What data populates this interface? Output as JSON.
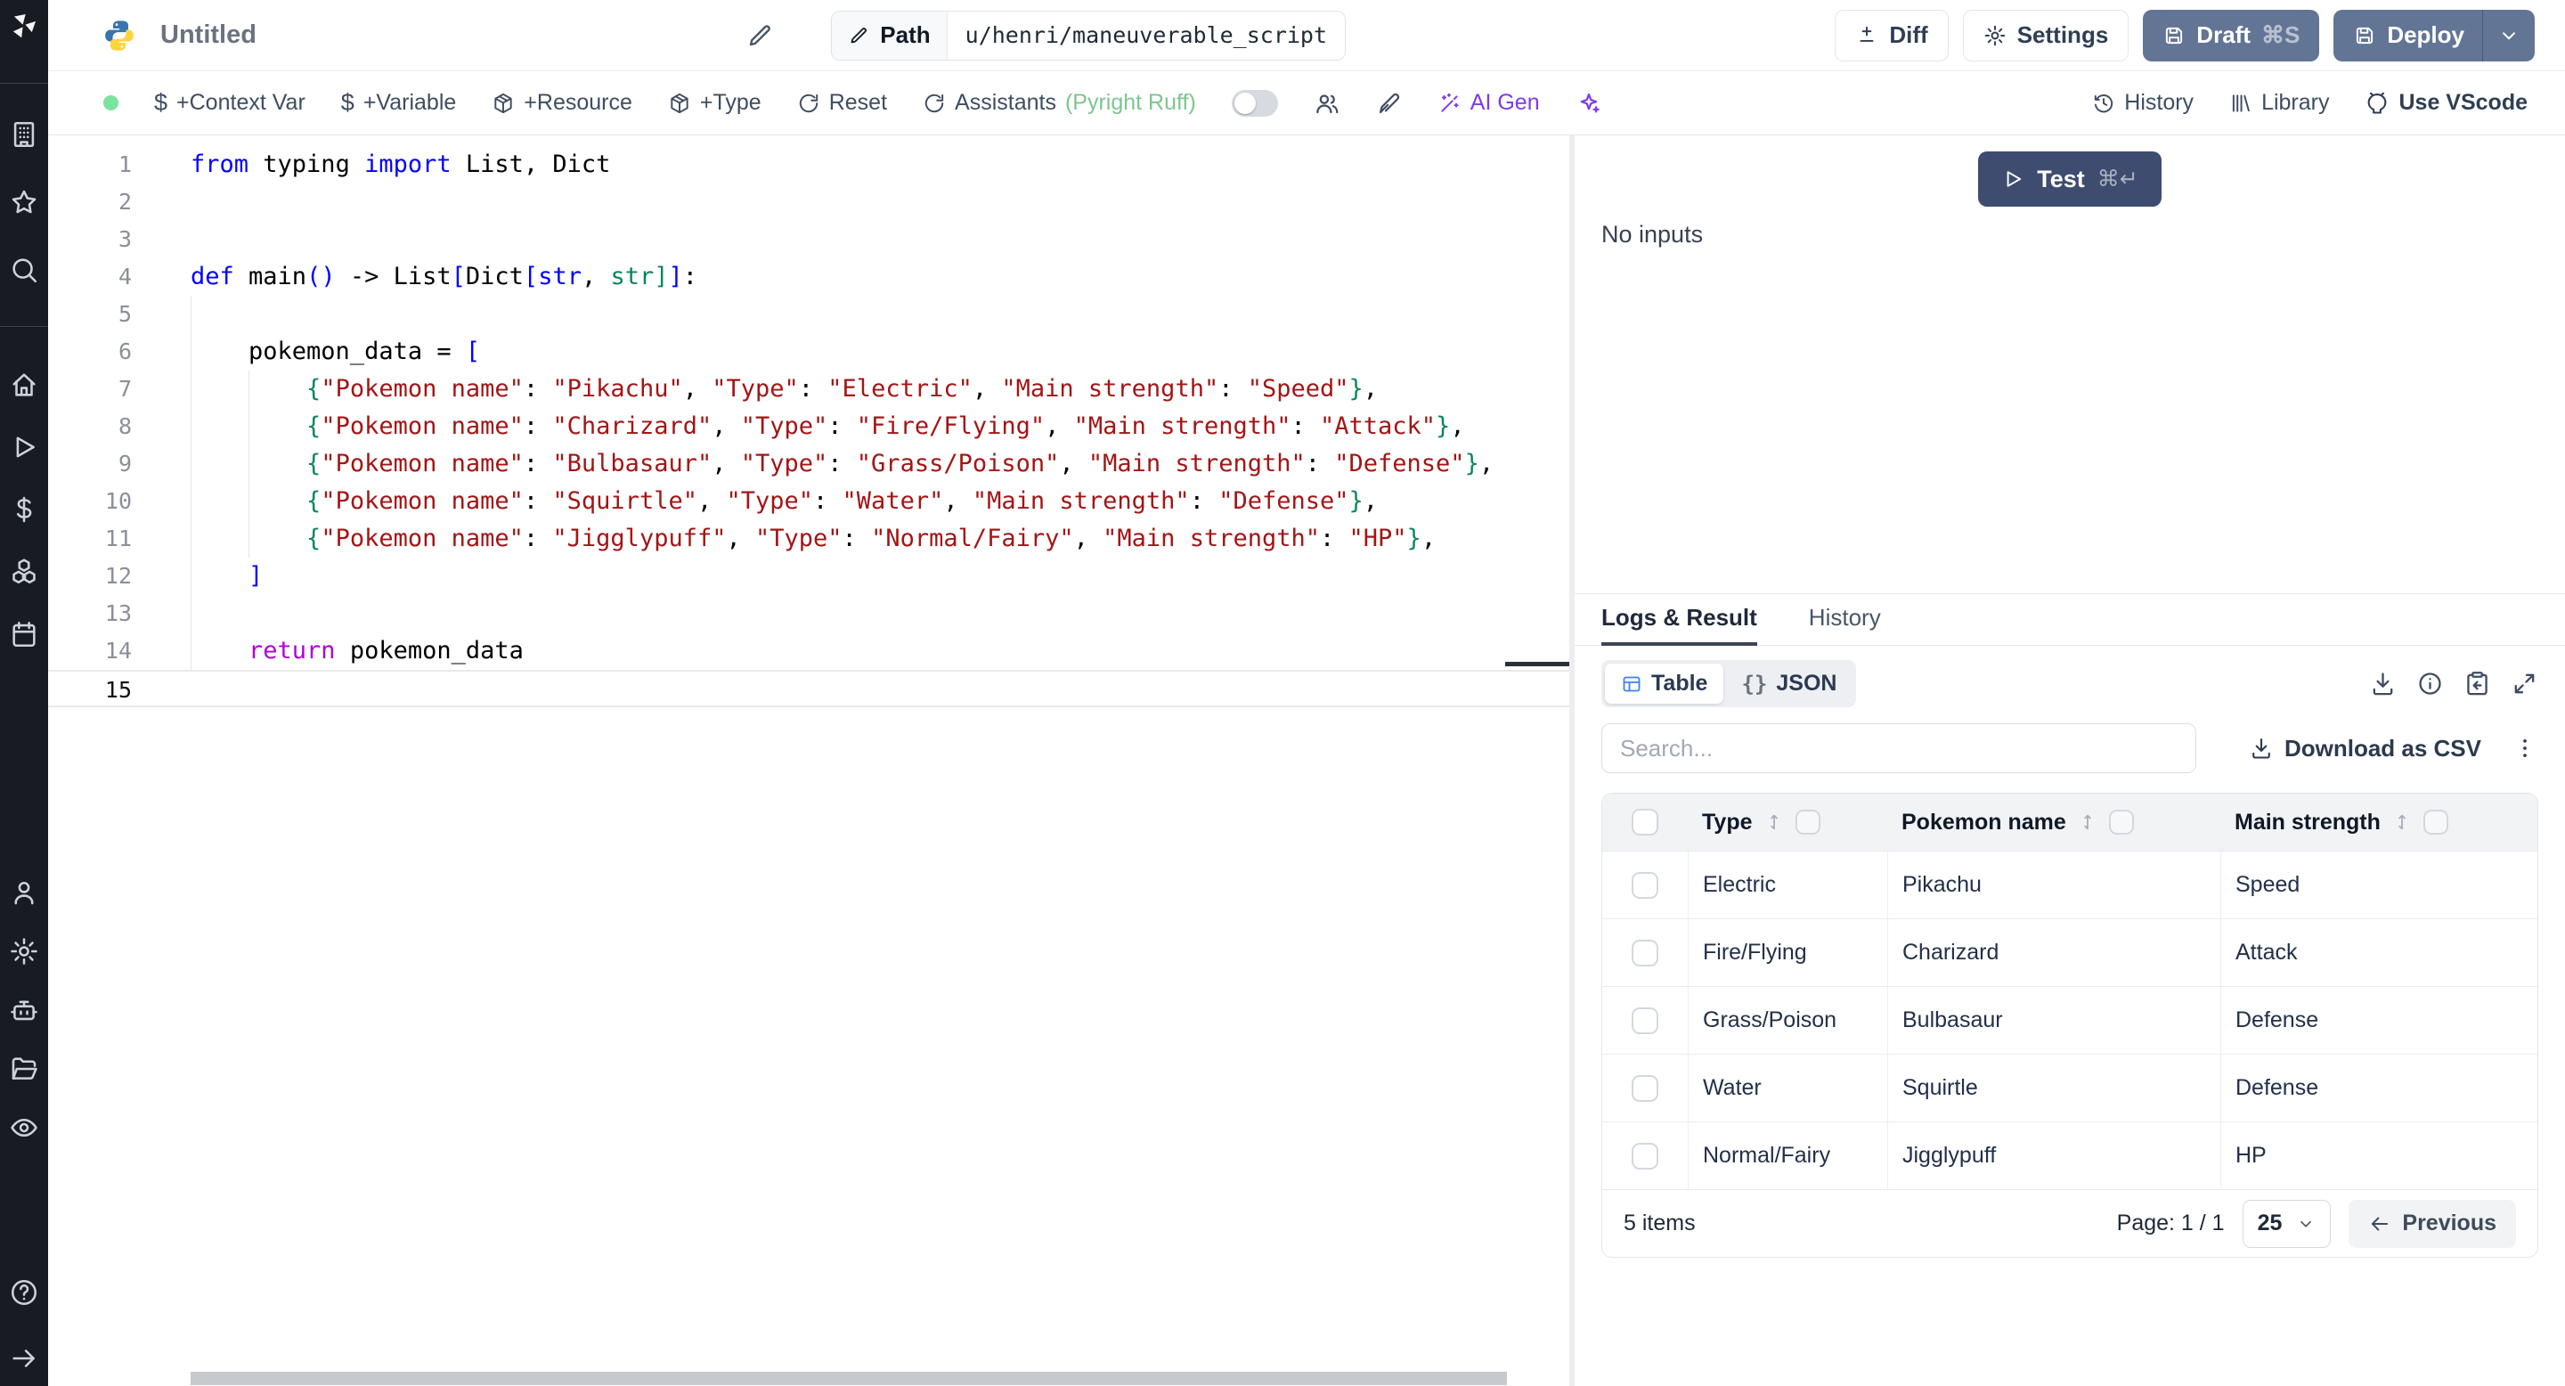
{
  "topbar": {
    "title": "Untitled",
    "path_label": "Path",
    "path_value": "u/henri/maneuverable_script",
    "diff_label": "Diff",
    "settings_label": "Settings",
    "draft_label": "Draft",
    "draft_shortcut": "⌘S",
    "deploy_label": "Deploy"
  },
  "toolbar": {
    "context_var": "+Context Var",
    "variable": "+Variable",
    "resource": "+Resource",
    "type": "+Type",
    "reset": "Reset",
    "assistants": "Assistants",
    "assistants_detail": "(Pyright Ruff)",
    "ai_gen": "AI Gen",
    "history": "History",
    "library": "Library",
    "use_vscode": "Use VScode"
  },
  "sidebar": {
    "groups": [
      [
        "workspace",
        "favorites",
        "search"
      ],
      [
        "home",
        "runs",
        "variables",
        "resources",
        "schedules"
      ],
      [
        "users",
        "settings",
        "workers",
        "folders",
        "audit-logs"
      ],
      [
        "help",
        "expand"
      ]
    ]
  },
  "editor": {
    "lines": [
      {
        "n": 1,
        "seg": [
          [
            "kw",
            "from"
          ],
          [
            "pl",
            " typing "
          ],
          [
            "kw",
            "import"
          ],
          [
            "pl",
            " List, Dict"
          ]
        ]
      },
      {
        "n": 2,
        "seg": []
      },
      {
        "n": 3,
        "seg": []
      },
      {
        "n": 4,
        "seg": [
          [
            "kw",
            "def"
          ],
          [
            "pl",
            " main"
          ],
          [
            "kw",
            "()"
          ],
          [
            "pl",
            " -> List"
          ],
          [
            "kw",
            "["
          ],
          [
            "pl",
            "Dict"
          ],
          [
            "kw",
            "["
          ],
          [
            "kw",
            "str"
          ],
          [
            "pl",
            ", "
          ],
          [
            "grn",
            "str"
          ],
          [
            "grn",
            "]"
          ],
          [
            "kw",
            "]"
          ],
          [
            "pl",
            ":"
          ]
        ]
      },
      {
        "n": 5,
        "seg": [],
        "g": [
          0
        ]
      },
      {
        "n": 6,
        "seg": [
          [
            "pl",
            "    pokemon_data = "
          ],
          [
            "kw",
            "["
          ]
        ],
        "g": [
          0
        ]
      },
      {
        "n": 7,
        "g": [
          0,
          4
        ],
        "seg": [
          [
            "pl",
            "        "
          ],
          [
            "grn",
            "{"
          ],
          [
            "str",
            "\"Pokemon name\""
          ],
          [
            "pl",
            ": "
          ],
          [
            "str",
            "\"Pikachu\""
          ],
          [
            "pl",
            ", "
          ],
          [
            "str",
            "\"Type\""
          ],
          [
            "pl",
            ": "
          ],
          [
            "str",
            "\"Electric\""
          ],
          [
            "pl",
            ", "
          ],
          [
            "str",
            "\"Main strength\""
          ],
          [
            "pl",
            ": "
          ],
          [
            "str",
            "\"Speed\""
          ],
          [
            "grn",
            "}"
          ],
          [
            "pl",
            ","
          ]
        ]
      },
      {
        "n": 8,
        "g": [
          0,
          4
        ],
        "seg": [
          [
            "pl",
            "        "
          ],
          [
            "grn",
            "{"
          ],
          [
            "str",
            "\"Pokemon name\""
          ],
          [
            "pl",
            ": "
          ],
          [
            "str",
            "\"Charizard\""
          ],
          [
            "pl",
            ", "
          ],
          [
            "str",
            "\"Type\""
          ],
          [
            "pl",
            ": "
          ],
          [
            "str",
            "\"Fire/Flying\""
          ],
          [
            "pl",
            ", "
          ],
          [
            "str",
            "\"Main strength\""
          ],
          [
            "pl",
            ": "
          ],
          [
            "str",
            "\"Attack\""
          ],
          [
            "grn",
            "}"
          ],
          [
            "pl",
            ","
          ]
        ]
      },
      {
        "n": 9,
        "g": [
          0,
          4
        ],
        "seg": [
          [
            "pl",
            "        "
          ],
          [
            "grn",
            "{"
          ],
          [
            "str",
            "\"Pokemon name\""
          ],
          [
            "pl",
            ": "
          ],
          [
            "str",
            "\"Bulbasaur\""
          ],
          [
            "pl",
            ", "
          ],
          [
            "str",
            "\"Type\""
          ],
          [
            "pl",
            ": "
          ],
          [
            "str",
            "\"Grass/Poison\""
          ],
          [
            "pl",
            ", "
          ],
          [
            "str",
            "\"Main strength\""
          ],
          [
            "pl",
            ": "
          ],
          [
            "str",
            "\"Defense\""
          ],
          [
            "grn",
            "}"
          ],
          [
            "pl",
            ","
          ]
        ]
      },
      {
        "n": 10,
        "g": [
          0,
          4
        ],
        "seg": [
          [
            "pl",
            "        "
          ],
          [
            "grn",
            "{"
          ],
          [
            "str",
            "\"Pokemon name\""
          ],
          [
            "pl",
            ": "
          ],
          [
            "str",
            "\"Squirtle\""
          ],
          [
            "pl",
            ", "
          ],
          [
            "str",
            "\"Type\""
          ],
          [
            "pl",
            ": "
          ],
          [
            "str",
            "\"Water\""
          ],
          [
            "pl",
            ", "
          ],
          [
            "str",
            "\"Main strength\""
          ],
          [
            "pl",
            ": "
          ],
          [
            "str",
            "\"Defense\""
          ],
          [
            "grn",
            "}"
          ],
          [
            "pl",
            ","
          ]
        ]
      },
      {
        "n": 11,
        "g": [
          0,
          4
        ],
        "seg": [
          [
            "pl",
            "        "
          ],
          [
            "grn",
            "{"
          ],
          [
            "str",
            "\"Pokemon name\""
          ],
          [
            "pl",
            ": "
          ],
          [
            "str",
            "\"Jigglypuff\""
          ],
          [
            "pl",
            ", "
          ],
          [
            "str",
            "\"Type\""
          ],
          [
            "pl",
            ": "
          ],
          [
            "str",
            "\"Normal/Fairy\""
          ],
          [
            "pl",
            ", "
          ],
          [
            "str",
            "\"Main strength\""
          ],
          [
            "pl",
            ": "
          ],
          [
            "str",
            "\"HP\""
          ],
          [
            "grn",
            "}"
          ],
          [
            "pl",
            ","
          ]
        ]
      },
      {
        "n": 12,
        "g": [
          0
        ],
        "seg": [
          [
            "pl",
            "    "
          ],
          [
            "kw",
            "]"
          ]
        ]
      },
      {
        "n": 13,
        "seg": [],
        "g": [
          0
        ]
      },
      {
        "n": 14,
        "g": [
          0
        ],
        "seg": [
          [
            "pl",
            "    "
          ],
          [
            "ctrl",
            "return"
          ],
          [
            "pl",
            " pokemon_data"
          ]
        ]
      },
      {
        "n": 15,
        "seg": [],
        "current": true
      }
    ]
  },
  "run_panel": {
    "test_label": "Test",
    "test_shortcut": "⌘↵",
    "no_inputs": "No inputs"
  },
  "result_panel": {
    "tab_logs": "Logs & Result",
    "tab_history": "History",
    "view_table": "Table",
    "view_json": "JSON",
    "json_braces": "{}",
    "search_placeholder": "Search...",
    "download_csv": "Download as CSV",
    "table": {
      "columns": [
        "Type",
        "Pokemon name",
        "Main strength"
      ],
      "rows": [
        [
          "Electric",
          "Pikachu",
          "Speed"
        ],
        [
          "Fire/Flying",
          "Charizard",
          "Attack"
        ],
        [
          "Grass/Poison",
          "Bulbasaur",
          "Defense"
        ],
        [
          "Water",
          "Squirtle",
          "Defense"
        ],
        [
          "Normal/Fairy",
          "Jigglypuff",
          "HP"
        ]
      ]
    },
    "footer": {
      "items": "5 items",
      "page": "Page: 1 / 1",
      "page_size": "25",
      "previous": "Previous"
    }
  },
  "colors": {
    "accent_blue": "#3b82f6",
    "button_slate": "#637595",
    "test_navy": "#3d4c6f",
    "status_green": "#7ce2a0",
    "assistant_green": "#7cc68f",
    "ai_purple": "#7c3aed",
    "string_red": "#a31515",
    "keyword_blue": "#0000ff",
    "control_purple": "#af00db",
    "bracket_green": "#098658"
  }
}
